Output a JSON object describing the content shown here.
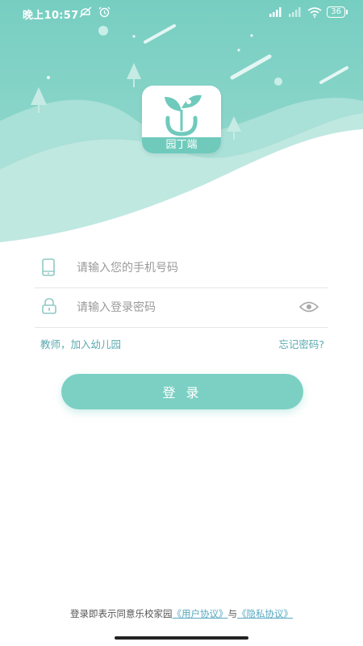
{
  "status_bar": {
    "time": "晚上10:57",
    "battery": "36",
    "icons": [
      "mute-icon",
      "alarm-icon",
      "signal-icon",
      "signal-icon",
      "wifi-icon",
      "battery-icon"
    ]
  },
  "logo": {
    "caption": "园丁端"
  },
  "phone_field": {
    "placeholder": "请输入您的手机号码",
    "icon": "phone-icon"
  },
  "password_field": {
    "placeholder": "请输入登录密码",
    "icon": "lock-icon",
    "toggle_icon": "eye-icon"
  },
  "links": {
    "join": "教师，加入幼儿园",
    "forgot": "忘记密码?"
  },
  "login_button": {
    "label": "登 录"
  },
  "agreement": {
    "prefix": "登录即表示同意乐校家园",
    "user_agreement": "《用户协议》",
    "joiner": "与",
    "privacy_agreement": "《隐私协议》"
  },
  "colors": {
    "accent": "#7cd0c3",
    "hero_top": "#79cfc2",
    "link": "#5aa9b0"
  }
}
